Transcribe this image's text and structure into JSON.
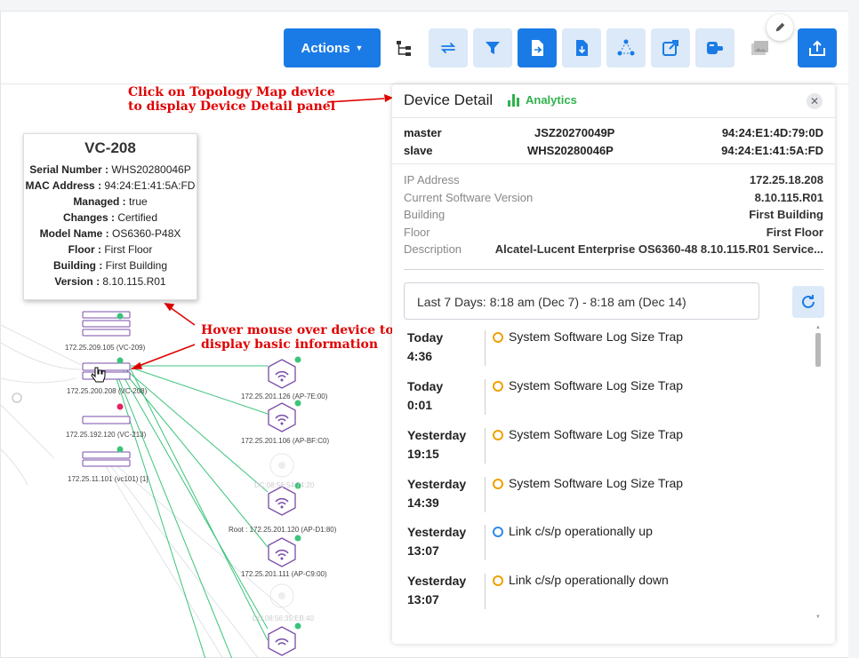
{
  "toolbar": {
    "actions_label": "Actions",
    "buttons": [
      "tree-view",
      "swap",
      "filter",
      "export",
      "import",
      "expand",
      "open-external",
      "toggle",
      "image",
      "upload"
    ]
  },
  "map": {
    "nodes": [
      {
        "label": "172.25.209.105 (VC-209)"
      },
      {
        "label": "172.25.200.208 (VC-208)"
      },
      {
        "label": "172.25.192.120 (VC-213)"
      },
      {
        "label": "172.25.11.101 (vc101) [1]"
      },
      {
        "label": "172.25.201.126 (AP-7E:00)"
      },
      {
        "label": "172.25.201.106 (AP-BF:C0)"
      },
      {
        "label": "DC:08:56:54:74:20"
      },
      {
        "label": "Root : 172.25.201.120 (AP-D1:80)"
      },
      {
        "label": "172.25.201.111 (AP-C9:00)"
      },
      {
        "label": "DC:08:56:35:EB:40"
      }
    ],
    "status_colors": {
      "up": "#3cc47c",
      "down": "#e0245e"
    }
  },
  "tooltip": {
    "title": "VC-208",
    "rows": [
      {
        "key": "Serial Number",
        "value": "WHS20280046P"
      },
      {
        "key": "MAC Address",
        "value": "94:24:E1:41:5A:FD"
      },
      {
        "key": "Managed",
        "value": "true"
      },
      {
        "key": "Changes",
        "value": "Certified"
      },
      {
        "key": "Model Name",
        "value": "OS6360-P48X"
      },
      {
        "key": "Floor",
        "value": "First Floor"
      },
      {
        "key": "Building",
        "value": "First Building"
      },
      {
        "key": "Version",
        "value": "8.10.115.R01"
      }
    ]
  },
  "annotations": {
    "click_line1": "Click on Topology Map device",
    "click_line2": "to display Device Detail panel",
    "hover_line1": "Hover mouse over device to",
    "hover_line2": "display basic information"
  },
  "panel": {
    "title": "Device Detail",
    "analytics_label": "Analytics",
    "stack": [
      {
        "role": "master",
        "serial": "JSZ20270049P",
        "mac": "94:24:E1:4D:79:0D"
      },
      {
        "role": "slave",
        "serial": "WHS20280046P",
        "mac": "94:24:E1:41:5A:FD"
      }
    ],
    "info": [
      {
        "label": "IP Address",
        "value": "172.25.18.208"
      },
      {
        "label": "Current Software Version",
        "value": "8.10.115.R01"
      },
      {
        "label": "Building",
        "value": "First Building"
      },
      {
        "label": "Floor",
        "value": "First Floor"
      },
      {
        "label": "Description",
        "value": "Alcatel-Lucent Enterprise OS6360-48 8.10.115.R01 Service..."
      }
    ],
    "range": "Last 7 Days: 8:18 am (Dec 7) - 8:18 am (Dec 14)",
    "events": [
      {
        "day": "Today",
        "time": "4:36",
        "message": "System Software Log Size Trap",
        "level": "warning"
      },
      {
        "day": "Today",
        "time": "0:01",
        "message": "System Software Log Size Trap",
        "level": "warning"
      },
      {
        "day": "Yesterday",
        "time": "19:15",
        "message": "System Software Log Size Trap",
        "level": "warning"
      },
      {
        "day": "Yesterday",
        "time": "14:39",
        "message": "System Software Log Size Trap",
        "level": "warning"
      },
      {
        "day": "Yesterday",
        "time": "13:07",
        "message": "Link c/s/p operationally up",
        "level": "info"
      },
      {
        "day": "Yesterday",
        "time": "13:07",
        "message": "Link c/s/p operationally down",
        "level": "warning"
      }
    ]
  }
}
